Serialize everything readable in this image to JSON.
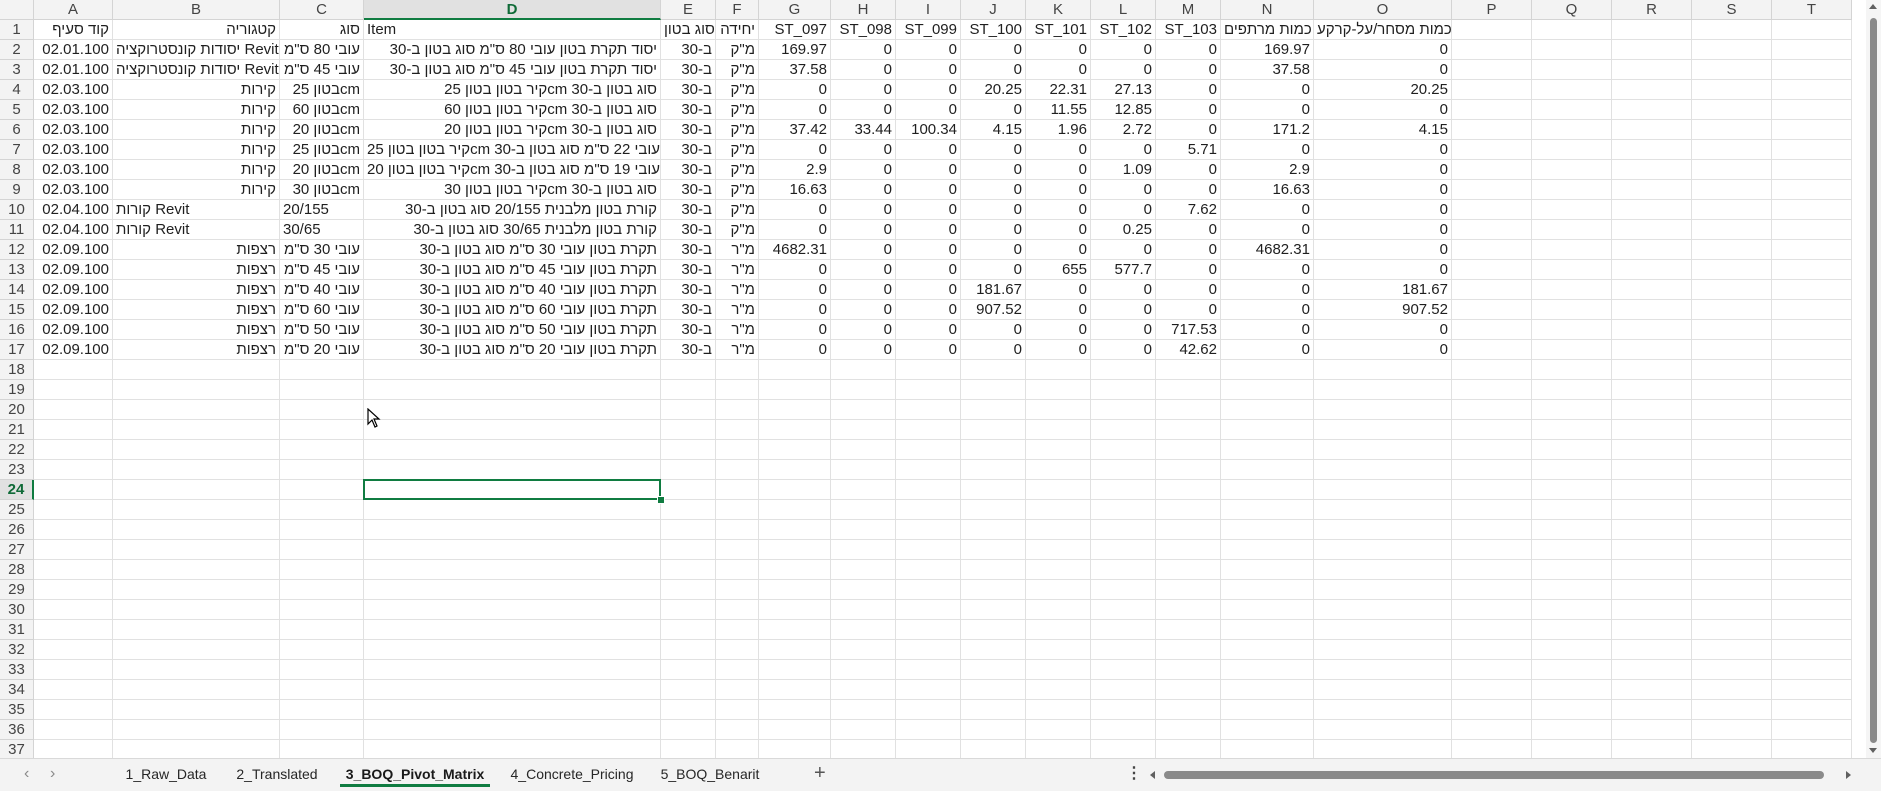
{
  "columns": [
    {
      "letter": "A"
    },
    {
      "letter": "B"
    },
    {
      "letter": "C"
    },
    {
      "letter": "D"
    },
    {
      "letter": "E"
    },
    {
      "letter": "F"
    },
    {
      "letter": "G"
    },
    {
      "letter": "H"
    },
    {
      "letter": "I"
    },
    {
      "letter": "J"
    },
    {
      "letter": "K"
    },
    {
      "letter": "L"
    },
    {
      "letter": "M"
    },
    {
      "letter": "N"
    },
    {
      "letter": "O"
    },
    {
      "letter": "P"
    },
    {
      "letter": "Q"
    },
    {
      "letter": "R"
    },
    {
      "letter": "S"
    },
    {
      "letter": "T"
    }
  ],
  "rows": [
    [
      "קוד סעיף",
      "קטגוריה",
      "סוג",
      "Item",
      "סוג בטון",
      "יחידה",
      "ST_097",
      "ST_098",
      "ST_099",
      "ST_100",
      "ST_101",
      "ST_102",
      "ST_103",
      "כמות מרתפים",
      "כמות מסחר/על-קרקע"
    ],
    [
      "02.01.100",
      "יסודות קונסטרוקציה Revit",
      "עובי 80 ס\"מ",
      "יסוד תקרת בטון עובי 80 ס\"מ סוג בטון ב-30",
      "ב-30",
      "מ\"ק",
      "169.97",
      "0",
      "0",
      "0",
      "0",
      "0",
      "0",
      "169.97",
      "0"
    ],
    [
      "02.01.100",
      "יסודות קונסטרוקציה Revit",
      "עובי 45 ס\"מ",
      "יסוד תקרת בטון עובי 45 ס\"מ סוג בטון ב-30",
      "ב-30",
      "מ\"ק",
      "37.58",
      "0",
      "0",
      "0",
      "0",
      "0",
      "0",
      "37.58",
      "0"
    ],
    [
      "02.03.100",
      "קירות",
      "בטון 25cm",
      "קיר בטון בטון 25cm סוג בטון ב-30",
      "ב-30",
      "מ\"ק",
      "0",
      "0",
      "0",
      "20.25",
      "22.31",
      "27.13",
      "0",
      "0",
      "20.25"
    ],
    [
      "02.03.100",
      "קירות",
      "בטון 60cm",
      "קיר בטון בטון 60cm סוג בטון ב-30",
      "ב-30",
      "מ\"ק",
      "0",
      "0",
      "0",
      "0",
      "11.55",
      "12.85",
      "0",
      "0",
      "0"
    ],
    [
      "02.03.100",
      "קירות",
      "בטון 20cm",
      "קיר בטון בטון 20cm סוג בטון ב-30",
      "ב-30",
      "מ\"ק",
      "37.42",
      "33.44",
      "100.34",
      "4.15",
      "1.96",
      "2.72",
      "0",
      "171.2",
      "4.15"
    ],
    [
      "02.03.100",
      "קירות",
      "בטון 25cm",
      "קיר בטון בטון 25cm עובי 22 ס\"מ סוג בטון ב-30",
      "ב-30",
      "מ\"ק",
      "0",
      "0",
      "0",
      "0",
      "0",
      "0",
      "5.71",
      "0",
      "0"
    ],
    [
      "02.03.100",
      "קירות",
      "בטון 20cm",
      "קיר בטון בטון 20cm עובי 19 ס\"מ סוג בטון ב-30",
      "ב-30",
      "מ\"ק",
      "2.9",
      "0",
      "0",
      "0",
      "0",
      "1.09",
      "0",
      "2.9",
      "0"
    ],
    [
      "02.03.100",
      "קירות",
      "בטון 30cm",
      "קיר בטון בטון 30cm סוג בטון ב-30",
      "ב-30",
      "מ\"ק",
      "16.63",
      "0",
      "0",
      "0",
      "0",
      "0",
      "0",
      "16.63",
      "0"
    ],
    [
      "02.04.100",
      "קורות Revit",
      "20/155",
      "קורת בטון מלבנית 20/155 סוג בטון ב-30",
      "ב-30",
      "מ\"ק",
      "0",
      "0",
      "0",
      "0",
      "0",
      "0",
      "7.62",
      "0",
      "0"
    ],
    [
      "02.04.100",
      "קורות Revit",
      "30/65",
      "קורת בטון מלבנית 30/65 סוג בטון ב-30",
      "ב-30",
      "מ\"ק",
      "0",
      "0",
      "0",
      "0",
      "0",
      "0.25",
      "0",
      "0",
      "0"
    ],
    [
      "02.09.100",
      "רצפות",
      "עובי 30 ס\"מ",
      "תקרת בטון עובי 30 ס\"מ סוג בטון ב-30",
      "ב-30",
      "מ\"ר",
      "4682.31",
      "0",
      "0",
      "0",
      "0",
      "0",
      "0",
      "4682.31",
      "0"
    ],
    [
      "02.09.100",
      "רצפות",
      "עובי 45 ס\"מ",
      "תקרת בטון עובי 45 ס\"מ סוג בטון ב-30",
      "ב-30",
      "מ\"ר",
      "0",
      "0",
      "0",
      "0",
      "655",
      "577.7",
      "0",
      "0",
      "0"
    ],
    [
      "02.09.100",
      "רצפות",
      "עובי 40 ס\"מ",
      "תקרת בטון עובי 40 ס\"מ סוג בטון ב-30",
      "ב-30",
      "מ\"ר",
      "0",
      "0",
      "0",
      "181.67",
      "0",
      "0",
      "0",
      "0",
      "181.67"
    ],
    [
      "02.09.100",
      "רצפות",
      "עובי 60 ס\"מ",
      "תקרת בטון עובי 60 ס\"מ סוג בטון ב-30",
      "ב-30",
      "מ\"ר",
      "0",
      "0",
      "0",
      "907.52",
      "0",
      "0",
      "0",
      "0",
      "907.52"
    ],
    [
      "02.09.100",
      "רצפות",
      "עובי 50 ס\"מ",
      "תקרת בטון עובי 50 ס\"מ סוג בטון ב-30",
      "ב-30",
      "מ\"ר",
      "0",
      "0",
      "0",
      "0",
      "0",
      "0",
      "717.53",
      "0",
      "0"
    ],
    [
      "02.09.100",
      "רצפות",
      "עובי 20 ס\"מ",
      "תקרת בטון עובי 20 ס\"מ סוג בטון ב-30",
      "ב-30",
      "מ\"ר",
      "0",
      "0",
      "0",
      "0",
      "0",
      "0",
      "42.62",
      "0",
      "0"
    ]
  ],
  "row_count": 38,
  "selection": {
    "cell": "D24",
    "column": "D",
    "row": 24
  },
  "sheet_tabs": [
    {
      "label": "1_Raw_Data",
      "active": false
    },
    {
      "label": "2_Translated",
      "active": false
    },
    {
      "label": "3_BOQ_Pivot_Matrix",
      "active": true
    },
    {
      "label": "4_Concrete_Pricing",
      "active": false
    },
    {
      "label": "5_BOQ_Benarit",
      "active": false
    }
  ],
  "tabbar": {
    "add_sheet": "+",
    "more": "⋮",
    "prev": "‹",
    "next": "›"
  },
  "colors": {
    "accent": "#107c41",
    "gridline": "#e1e1e1",
    "header_bg": "#f3f3f3"
  }
}
